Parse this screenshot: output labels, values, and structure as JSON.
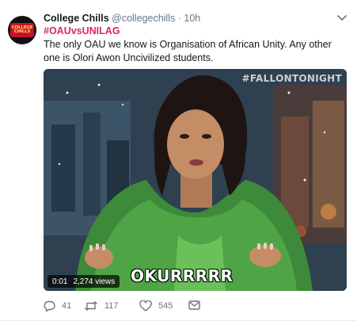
{
  "tweet": {
    "author_name": "College Chills",
    "handle": "@collegechills",
    "separator": "·",
    "time": "10h",
    "hashtag": "#OAUvsUNILAG",
    "text": "The only OAU we know is Organisation of African Unity. Any other one is Olori Awon Uncivilized students.",
    "avatar_text": "COLLEGE CHILLS"
  },
  "media": {
    "watermark": "#FALLONTONIGHT",
    "caption": "OKURRRRR",
    "duration": "0:01",
    "views": "2,274 views"
  },
  "actions": {
    "reply_count": "41",
    "retweet_count": "117",
    "like_count": "545"
  },
  "icons": {
    "reply": "reply-icon",
    "retweet": "retweet-icon",
    "like": "heart-icon",
    "dm": "envelope-icon",
    "caret": "chevron-down-icon"
  },
  "colors": {
    "hashtag": "#e0245e",
    "secondary_text": "#657786",
    "primary_text": "#14171a"
  }
}
